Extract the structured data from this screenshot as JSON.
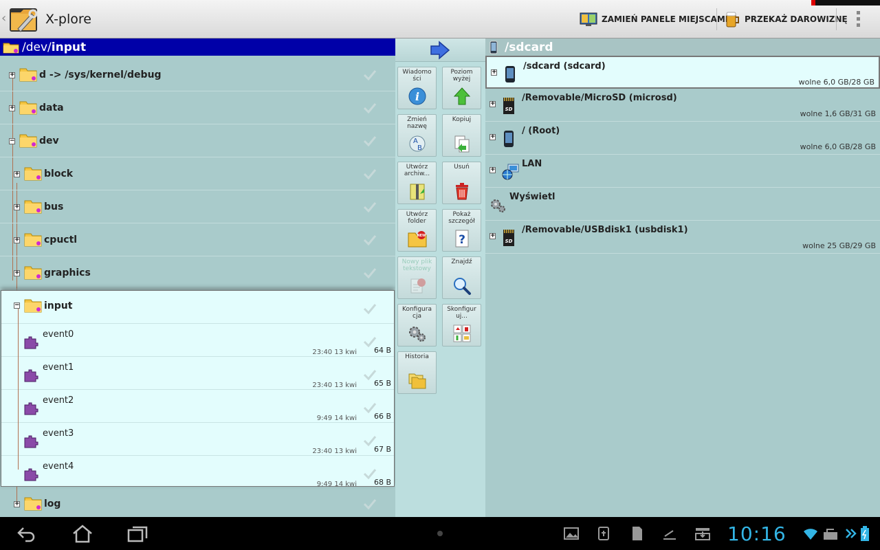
{
  "app": {
    "title": "X-plore"
  },
  "actionbar": {
    "swap_label": "ZAMIEŃ PANELE MIEJSCAMI",
    "donate_label": "PRZEKAŻ DAROWIZNĘ"
  },
  "left": {
    "path_prefix": "/dev/",
    "path_current": "input",
    "folders_top": [
      {
        "name": "d -> /sys/kernel/debug",
        "expanded": false
      },
      {
        "name": "data",
        "expanded": false
      },
      {
        "name": "dev",
        "expanded": true
      }
    ],
    "subfolders": [
      {
        "name": "block"
      },
      {
        "name": "bus"
      },
      {
        "name": "cpuctl"
      },
      {
        "name": "graphics"
      }
    ],
    "open_folder": "input",
    "files": [
      {
        "name": "event0",
        "date": "23:40 13 kwi",
        "size": "64 B"
      },
      {
        "name": "event1",
        "date": "23:40 13 kwi",
        "size": "65 B"
      },
      {
        "name": "event2",
        "date": "9:49 14 kwi",
        "size": "66 B"
      },
      {
        "name": "event3",
        "date": "23:40 13 kwi",
        "size": "67 B"
      },
      {
        "name": "event4",
        "date": "9:49 14 kwi",
        "size": "68 B"
      }
    ],
    "after_folder": "log"
  },
  "tools": [
    {
      "label": "Wiadomo ści",
      "icon": "info-icon",
      "enabled": true
    },
    {
      "label": "Poziom wyżej",
      "icon": "up-arrow-icon",
      "enabled": true
    },
    {
      "label": "Zmień nazwę",
      "icon": "rename-icon",
      "enabled": true
    },
    {
      "label": "Kopiuj",
      "icon": "copy-icon",
      "enabled": true
    },
    {
      "label": "Utwórz archiw...",
      "icon": "archive-icon",
      "enabled": true
    },
    {
      "label": "Usuń",
      "icon": "trash-icon",
      "enabled": true
    },
    {
      "label": "Utwórz folder",
      "icon": "new-folder-icon",
      "enabled": true
    },
    {
      "label": "Pokaż szczegół",
      "icon": "details-icon",
      "enabled": true
    },
    {
      "label": "Nowy plik tekstowy",
      "icon": "new-text-file-icon",
      "enabled": false
    },
    {
      "label": "Znajdź",
      "icon": "search-icon",
      "enabled": true
    },
    {
      "label": "Konfigura cja",
      "icon": "gears-icon",
      "enabled": true
    },
    {
      "label": "Skonfigur uj...",
      "icon": "configure-icon",
      "enabled": true
    },
    {
      "label": "Historia",
      "icon": "history-icon",
      "enabled": true
    }
  ],
  "right": {
    "path": "/sdcard",
    "drives": [
      {
        "name": "/sdcard (sdcard)",
        "free": "wolne 6,0 GB/28 GB",
        "icon": "phone-icon",
        "selected": true
      },
      {
        "name": "/Removable/MicroSD (microsd)",
        "free": "wolne 1,6 GB/31 GB",
        "icon": "sd-card-icon",
        "selected": false
      },
      {
        "name": "/ (Root)",
        "free": "wolne 6,0 GB/28 GB",
        "icon": "phone-icon",
        "selected": false
      },
      {
        "name": "LAN",
        "free": "",
        "icon": "lan-icon",
        "selected": false
      },
      {
        "name": "Wyświetl",
        "free": "",
        "icon": "gears-icon",
        "selected": false
      },
      {
        "name": "/Removable/USBdisk1 (usbdisk1)",
        "free": "wolne 25 GB/29 GB",
        "icon": "sd-card-icon",
        "selected": false
      }
    ]
  },
  "statusbar": {
    "time": "10:16"
  },
  "colors": {
    "path_bar": "#0000a8",
    "pane_bg": "#a9cbcb",
    "selection_bg": "#e3fdfd",
    "clock": "#33b5e5"
  }
}
